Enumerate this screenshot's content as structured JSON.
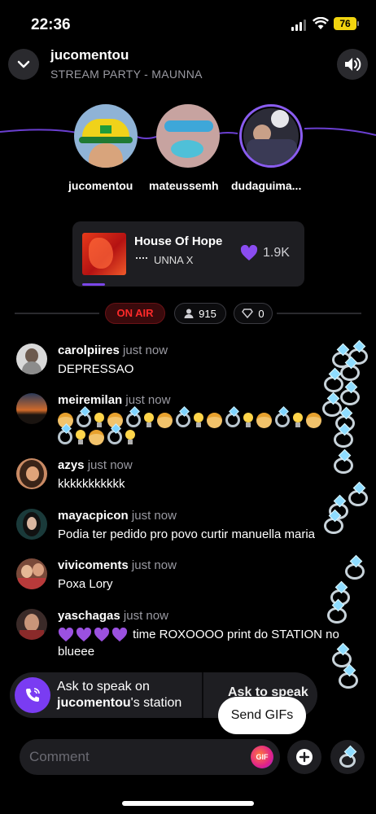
{
  "status": {
    "time": "22:36",
    "battery": "76"
  },
  "header": {
    "title": "jucomentou",
    "subtitle": "STREAM PARTY - MAUNNA"
  },
  "hosts": [
    {
      "name": "jucomentou"
    },
    {
      "name": "mateussemh"
    },
    {
      "name": "dudaguima..."
    }
  ],
  "now_playing": {
    "title": "House Of Hope",
    "artist": "UNNA X",
    "likes": "1.9K"
  },
  "live": {
    "on_air_label": "ON AIR",
    "listeners": "915",
    "diamonds": "0"
  },
  "comments": [
    {
      "user": "carolpiires",
      "time": "just now",
      "text": "DEPRESSAO"
    },
    {
      "user": "meiremilan",
      "time": "just now",
      "text": ""
    },
    {
      "user": "azys",
      "time": "just now",
      "text": "kkkkkkkkkkk"
    },
    {
      "user": "mayacpicon",
      "time": "just now",
      "text": "Podia ter pedido pro povo curtir manuella maria"
    },
    {
      "user": "vivicoments",
      "time": "just now",
      "text": "Poxa Lory"
    },
    {
      "user": "yaschagas",
      "time": "just now",
      "text": "time ROXOOOO print do STATION no blueee"
    }
  ],
  "speak": {
    "line1": "Ask to speak on",
    "station_user": "jucomentou",
    "line2_suffix": "'s station",
    "second_label": "Ask to speak"
  },
  "tooltip": "Send GIFs",
  "comment_bar": {
    "placeholder": "Comment",
    "gif_label": "GIF"
  },
  "colors": {
    "accent": "#7a3cf2",
    "on_air": "#ff2a2a",
    "battery": "#f1d40f"
  }
}
